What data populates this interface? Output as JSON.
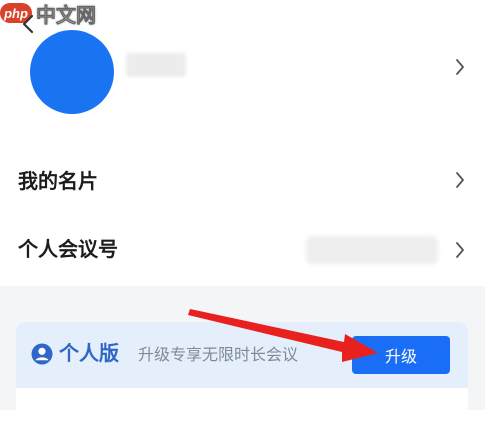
{
  "watermark": {
    "logo_text": "php",
    "text": "中文网"
  },
  "profile": {
    "name": ""
  },
  "menu": {
    "card_label": "我的名片",
    "meeting_id_label": "个人会议号",
    "meeting_id_value": ""
  },
  "plan_card": {
    "edition": "个人版",
    "description": "升级专享无限时长会议",
    "upgrade_label": "升级"
  },
  "colors": {
    "accent": "#1a6ef5",
    "avatar": "#1a73f0",
    "edition_text": "#2f67c9",
    "annotation_arrow": "#e8201e"
  },
  "icons": [
    "back-icon",
    "chevron-right-icon",
    "user-icon"
  ]
}
